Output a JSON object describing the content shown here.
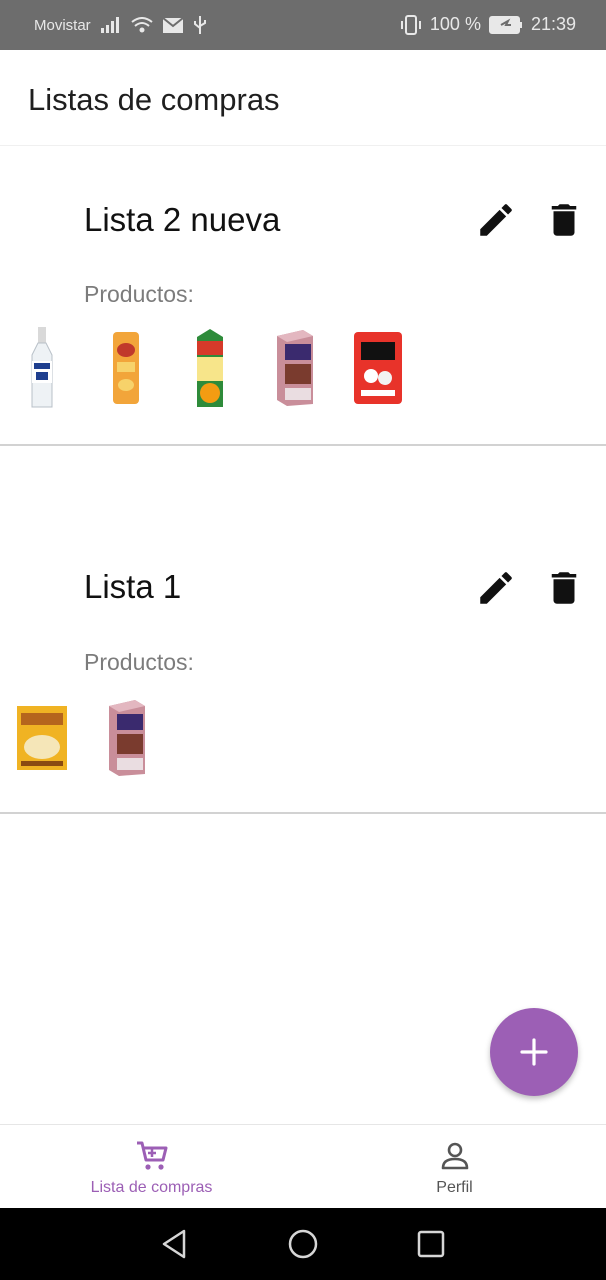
{
  "status_bar": {
    "carrier": "Movistar",
    "battery": "100 %",
    "time": "21:39",
    "icons": [
      "signal-icon",
      "wifi-icon",
      "mail-icon",
      "usb-icon",
      "vibrate-icon",
      "battery-charging-icon"
    ]
  },
  "app_bar": {
    "title": "Listas de compras"
  },
  "lists": [
    {
      "name": "Lista 2 nueva",
      "products_label": "Productos:",
      "products": [
        "vodka-bottle",
        "pringles-can",
        "orange-juice-carton",
        "vita-chocolate-milk",
        "new-york-candy-bag"
      ]
    },
    {
      "name": "Lista 1",
      "products_label": "Productos:",
      "products": [
        "risotto-package",
        "vita-chocolate-milk"
      ]
    }
  ],
  "fab": {
    "icon": "plus-icon"
  },
  "bottom_nav": {
    "items": [
      {
        "label": "Lista de compras",
        "icon": "cart-icon",
        "active": true
      },
      {
        "label": "Perfil",
        "icon": "person-icon",
        "active": false
      }
    ]
  },
  "colors": {
    "accent": "#9c5fb5",
    "status_bar": "#6d6d6d",
    "divider": "#d2d2d2"
  }
}
